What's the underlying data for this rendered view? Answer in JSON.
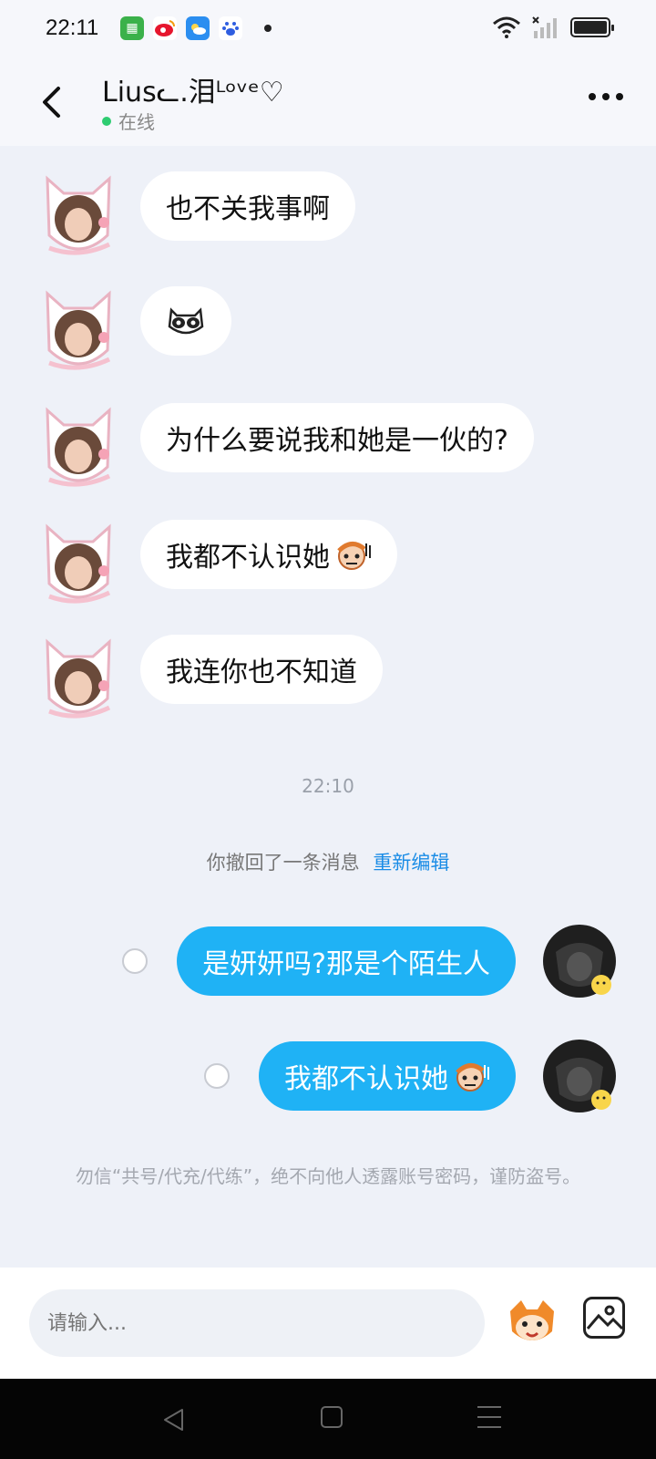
{
  "status_bar": {
    "time": "22:11",
    "apps": [
      "grid-app-icon",
      "weibo-icon",
      "weather-icon",
      "baidu-icon"
    ]
  },
  "header": {
    "contact_name": "Liusᓚ.泪ᴸᵒᵛᵉ♡",
    "status": "在线"
  },
  "messages_in": [
    {
      "text": "也不关我事啊"
    },
    {
      "text": "",
      "sticker": "bear-sticker"
    },
    {
      "text": "为什么要说我和她是一伙的?"
    },
    {
      "text": "我都不认识她",
      "sticker": "face-emoji"
    },
    {
      "text": "我连你也不知道"
    }
  ],
  "time_divider": "22:10",
  "recall": {
    "text": "你撤回了一条消息",
    "action": "重新编辑"
  },
  "messages_out": [
    {
      "text": "是妍妍吗?那是个陌生人"
    },
    {
      "text": "我都不认识她",
      "sticker": "face-emoji"
    }
  ],
  "notice": "勿信“共号/代充/代练”，绝不向他人透露账号密码，谨防盗号。",
  "input": {
    "placeholder": "请输入..."
  },
  "colors": {
    "outgoing_bubble": "#1fb2f5",
    "link": "#1a8ce6",
    "online": "#2ecc71"
  }
}
